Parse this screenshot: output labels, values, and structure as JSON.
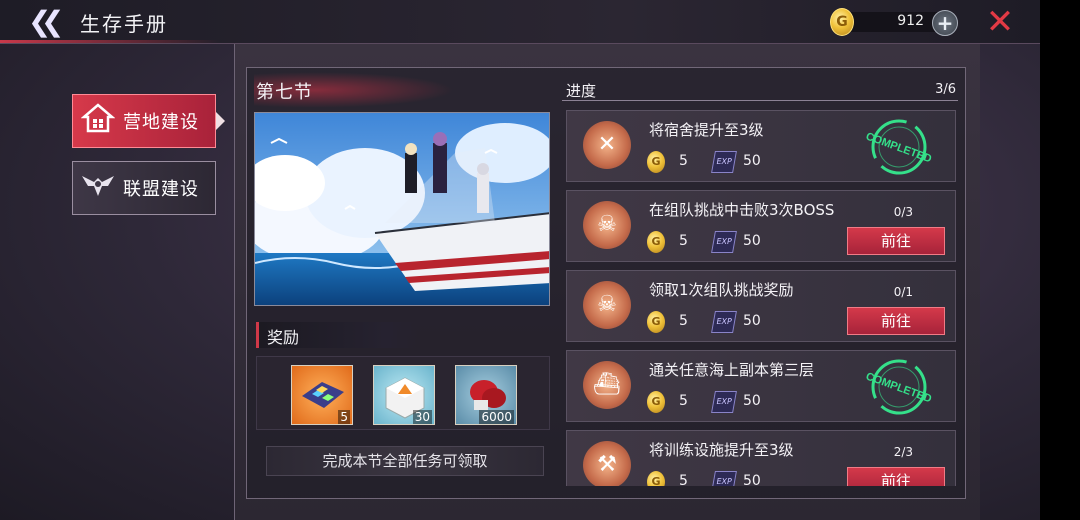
{
  "header": {
    "title": "生存手册",
    "coins": "912",
    "coin_glyph": "G"
  },
  "sidebar": {
    "items": [
      {
        "label": "营地建设",
        "active": true,
        "icon": "home-icon"
      },
      {
        "label": "联盟建设",
        "active": false,
        "icon": "alliance-wings-icon"
      }
    ]
  },
  "section": {
    "title": "第七节",
    "rewards_title": "奖励",
    "rewards": [
      {
        "qty": "5",
        "icon": "building-blueprint-icon"
      },
      {
        "qty": "30",
        "icon": "supply-cube-icon"
      },
      {
        "qty": "6000",
        "icon": "boxing-glove-icon"
      }
    ],
    "claim_note": "完成本节全部任务可领取"
  },
  "progress": {
    "label": "进度",
    "count": "3/6"
  },
  "tasks": [
    {
      "name": "将宿舍提升至3级",
      "icon": "wrench-screwdriver-icon",
      "coin": "5",
      "exp": "50",
      "status": "completed",
      "stamp": "COMPLETED"
    },
    {
      "name": "在组队挑战中击败3次BOSS",
      "icon": "crossed-swords-skull-icon",
      "coin": "5",
      "exp": "50",
      "status": "in_progress",
      "progress": "0/3",
      "button": "前往"
    },
    {
      "name": "领取1次组队挑战奖励",
      "icon": "crossed-swords-skull-icon",
      "coin": "5",
      "exp": "50",
      "status": "in_progress",
      "progress": "0/1",
      "button": "前往"
    },
    {
      "name": "通关任意海上副本第三层",
      "icon": "ship-icon",
      "coin": "5",
      "exp": "50",
      "status": "completed",
      "stamp": "COMPLETED"
    },
    {
      "name": "将训练设施提升至3级",
      "icon": "hammer-icon",
      "coin": "5",
      "exp": "50",
      "status": "in_progress",
      "progress": "2/3",
      "button": "前往"
    }
  ],
  "exp_glyph": "EXP",
  "colors": {
    "accent_red": "#d4394a",
    "completed_green": "#35e08a",
    "gold": "#f0c23a"
  }
}
